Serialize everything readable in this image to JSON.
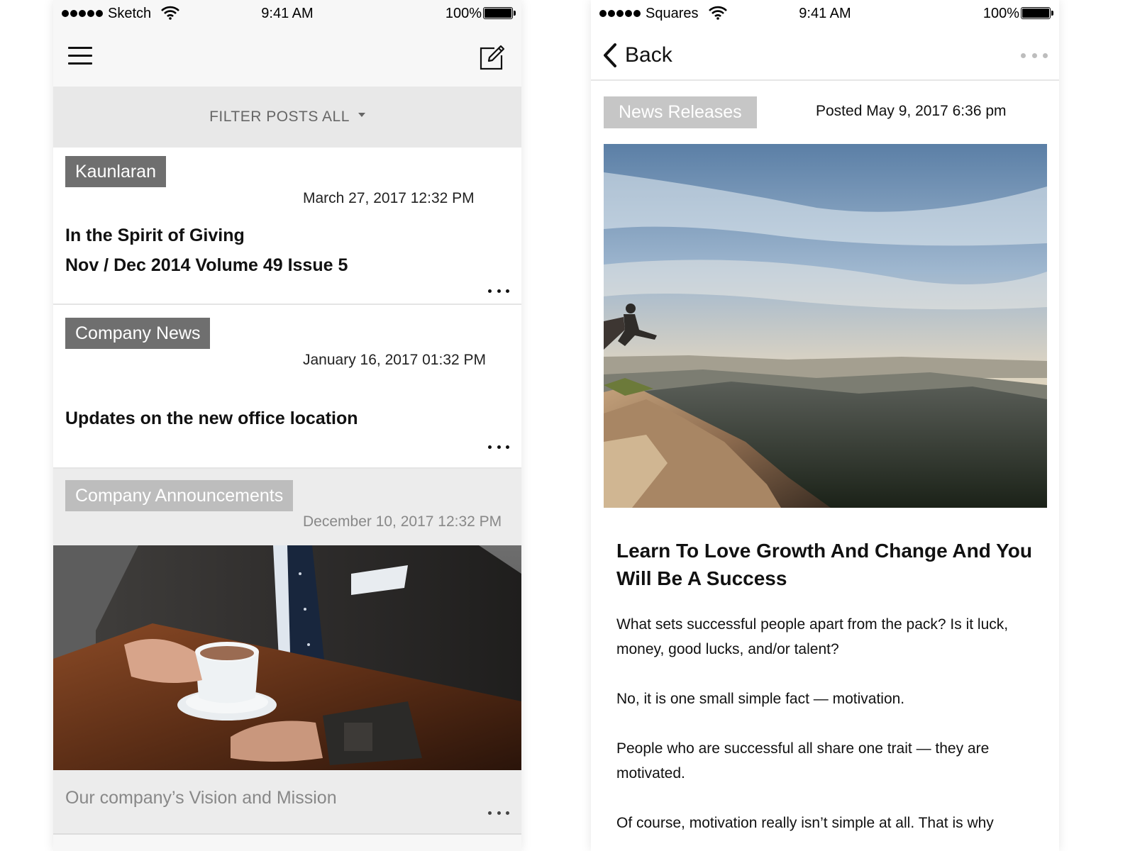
{
  "left_screen": {
    "status_bar": {
      "carrier": "Sketch",
      "time": "9:41 AM",
      "battery": "100%"
    },
    "header": {
      "menu_icon": "hamburger-icon",
      "compose_icon": "compose-icon"
    },
    "filter": {
      "label": "FILTER POSTS ALL"
    },
    "posts": [
      {
        "tag": "Kaunlaran",
        "date": "March 27, 2017 12:32 PM",
        "title_line1": "In the Spirit of Giving",
        "title_line2": "Nov / Dec 2014  Volume 49 Issue 5"
      },
      {
        "tag": "Company News",
        "date": "January 16, 2017 01:32 PM",
        "title_line1": "Updates on the new office location"
      },
      {
        "tag": "Company Announcements",
        "date": "December 10, 2017 12:32 PM",
        "title_line1": "Our company’s Vision and Mission"
      }
    ]
  },
  "right_screen": {
    "status_bar": {
      "carrier": "Squares",
      "time": "9:41 AM",
      "battery": "100%"
    },
    "header": {
      "back_label": "Back"
    },
    "article": {
      "category": "News Releases",
      "posted": "Posted May 9, 2017 6:36 pm",
      "title": "Learn To Love Growth And Change And You Will Be A Success",
      "paragraphs": [
        "What sets successful people apart from the pack? Is it luck, money, good lucks, and/or talent?",
        "No, it is one small simple fact — motivation.",
        "People who are successful all share one trait — they are motivated.",
        "Of course, motivation really isn’t simple at all. That is why"
      ]
    }
  },
  "colors": {
    "tag_dark": "#6f6f6f",
    "tag_light": "#bdbdbd",
    "news_tag": "#c6c6c6",
    "filter_bar": "#e8e8e8",
    "header_bg": "#f7f7f7"
  }
}
